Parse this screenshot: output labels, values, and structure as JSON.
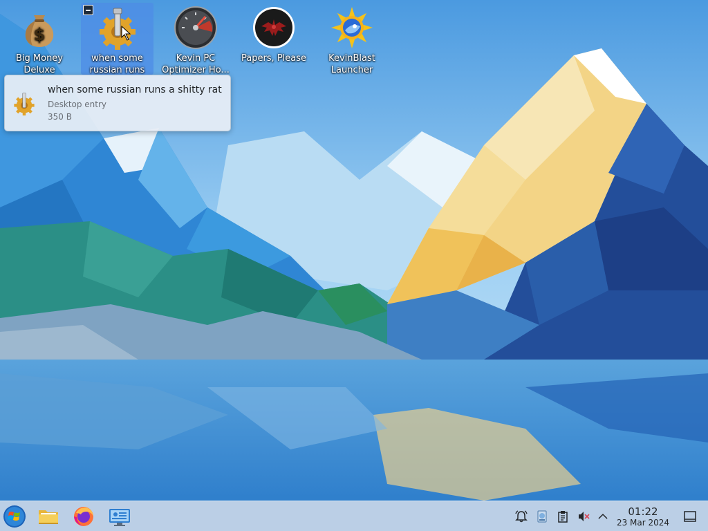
{
  "desktop": {
    "icons": [
      {
        "label": "Big Money Deluxe",
        "icon": "money-bag-icon"
      },
      {
        "label": "when some russian runs a...",
        "icon": "gear-wrench-icon",
        "selected": true
      },
      {
        "label": "Kevin PC Optimizer Ho...",
        "icon": "speedometer-icon"
      },
      {
        "label": "Papers, Please",
        "icon": "eagle-emblem-icon"
      },
      {
        "label": "KevinBlast Launcher",
        "icon": "sun-disc-icon"
      }
    ]
  },
  "tooltip": {
    "title": "when some russian runs a shitty rat",
    "type": "Desktop entry",
    "size": "350 B",
    "icon": "gear-wrench-icon"
  },
  "taskbar": {
    "launchers": [
      {
        "name": "start-menu",
        "icon": "windows-logo-icon"
      },
      {
        "name": "file-manager",
        "icon": "folder-icon"
      },
      {
        "name": "firefox",
        "icon": "firefox-icon"
      },
      {
        "name": "system-settings",
        "icon": "system-monitor-icon"
      }
    ],
    "tray": [
      {
        "name": "notifications",
        "icon": "bell-icon"
      },
      {
        "name": "disks",
        "icon": "disk-icon"
      },
      {
        "name": "clipboard",
        "icon": "clipboard-icon"
      },
      {
        "name": "volume",
        "icon": "speaker-muted-icon"
      },
      {
        "name": "expand",
        "icon": "chevron-up-icon"
      }
    ],
    "clock": {
      "time": "01:22",
      "date": "23 Mar 2024"
    },
    "show_desktop_icon": "show-desktop-icon"
  },
  "colors": {
    "selection": "#4d8ce6",
    "taskbar": "#c8d6e8",
    "text_dark": "#232629"
  }
}
